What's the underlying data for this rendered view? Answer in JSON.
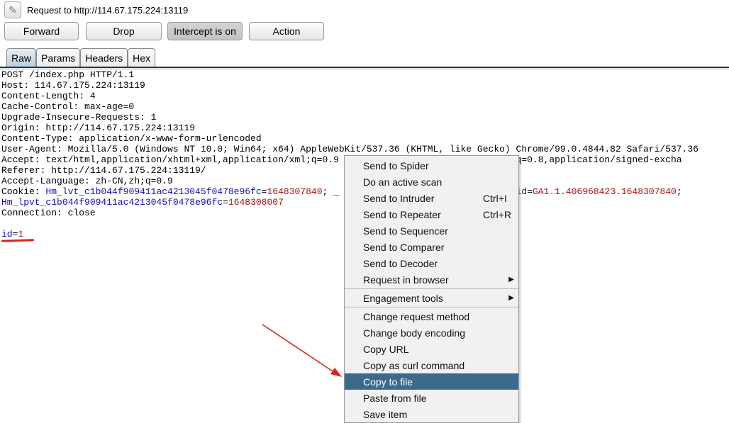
{
  "title": "Request to http://114.67.175.224:13119",
  "buttons": {
    "forward": "Forward",
    "drop": "Drop",
    "intercept": "Intercept is on",
    "action": "Action"
  },
  "tabs": [
    "Raw",
    "Params",
    "Headers",
    "Hex"
  ],
  "request_lines": [
    [
      {
        "t": "POST /index.php HTTP/1.1",
        "c": "k"
      }
    ],
    [
      {
        "t": "Host: 114.67.175.224:13119",
        "c": "k"
      }
    ],
    [
      {
        "t": "Content-Length: 4",
        "c": "k"
      }
    ],
    [
      {
        "t": "Cache-Control: max-age=0",
        "c": "k"
      }
    ],
    [
      {
        "t": "Upgrade-Insecure-Requests: 1",
        "c": "k"
      }
    ],
    [
      {
        "t": "Origin: http://114.67.175.224:13119",
        "c": "k"
      }
    ],
    [
      {
        "t": "Content-Type: application/x-www-form-urlencoded",
        "c": "k"
      }
    ],
    [
      {
        "t": "User-Agent: Mozilla/5.0 (Windows NT 10.0; Win64; x64) AppleWebKit/537.36 (KHTML, like Gecko) Chrome/99.0.4844.82 Safari/537.36",
        "c": "k"
      }
    ],
    [
      {
        "t": "Accept: text/html,application/xhtml+xml,application/xml;q=0.9",
        "c": "k"
      },
      {
        "t": "                        ",
        "c": "k"
      },
      {
        "t": "png,*/*;q=0.8,application/signed-excha",
        "c": "k"
      }
    ],
    [
      {
        "t": "Referer: http://114.67.175.224:13119/",
        "c": "k"
      }
    ],
    [
      {
        "t": "Accept-Language: zh-CN,zh;q=0.9",
        "c": "k"
      }
    ],
    [
      {
        "t": "Cookie: ",
        "c": "k"
      },
      {
        "t": "Hm_lvt_c1b044f909411ac4213045f0478e96fc",
        "c": "n"
      },
      {
        "t": "=",
        "c": "k"
      },
      {
        "t": "1648307840",
        "c": "v"
      },
      {
        "t": "; ",
        "c": "k"
      },
      {
        "t": "_",
        "c": "n"
      },
      {
        "t": "                            ; ",
        "c": "k"
      },
      {
        "t": "_gid",
        "c": "n"
      },
      {
        "t": "=",
        "c": "k"
      },
      {
        "t": "GA1.1.406968423.1648307840",
        "c": "v"
      },
      {
        "t": ";",
        "c": "k"
      }
    ],
    [
      {
        "t": "Hm_lpvt_c1b044f909411ac4213045f0478e96fc",
        "c": "n"
      },
      {
        "t": "=",
        "c": "k"
      },
      {
        "t": "1648308007",
        "c": "v"
      }
    ],
    [
      {
        "t": "Connection: close",
        "c": "k"
      }
    ],
    [
      {
        "t": " ",
        "c": "k"
      }
    ],
    [
      {
        "t": "id",
        "c": "n"
      },
      {
        "t": "=",
        "c": "k"
      },
      {
        "t": "1",
        "c": "v"
      }
    ]
  ],
  "context_menu": [
    {
      "label": "Send to Spider"
    },
    {
      "label": "Do an active scan"
    },
    {
      "label": "Send to Intruder",
      "shortcut": "Ctrl+I"
    },
    {
      "label": "Send to Repeater",
      "shortcut": "Ctrl+R"
    },
    {
      "label": "Send to Sequencer"
    },
    {
      "label": "Send to Comparer"
    },
    {
      "label": "Send to Decoder"
    },
    {
      "label": "Request in browser",
      "submenu": true,
      "sep_after": true
    },
    {
      "label": "Engagement tools",
      "submenu": true,
      "sep_after": true
    },
    {
      "label": "Change request method"
    },
    {
      "label": "Change body encoding"
    },
    {
      "label": "Copy URL"
    },
    {
      "label": "Copy as curl command"
    },
    {
      "label": "Copy to file",
      "highlighted": true
    },
    {
      "label": "Paste from file"
    },
    {
      "label": "Save item"
    }
  ],
  "colors": {
    "highlight": "#3b6a8c",
    "annotation": "#e0201c"
  }
}
